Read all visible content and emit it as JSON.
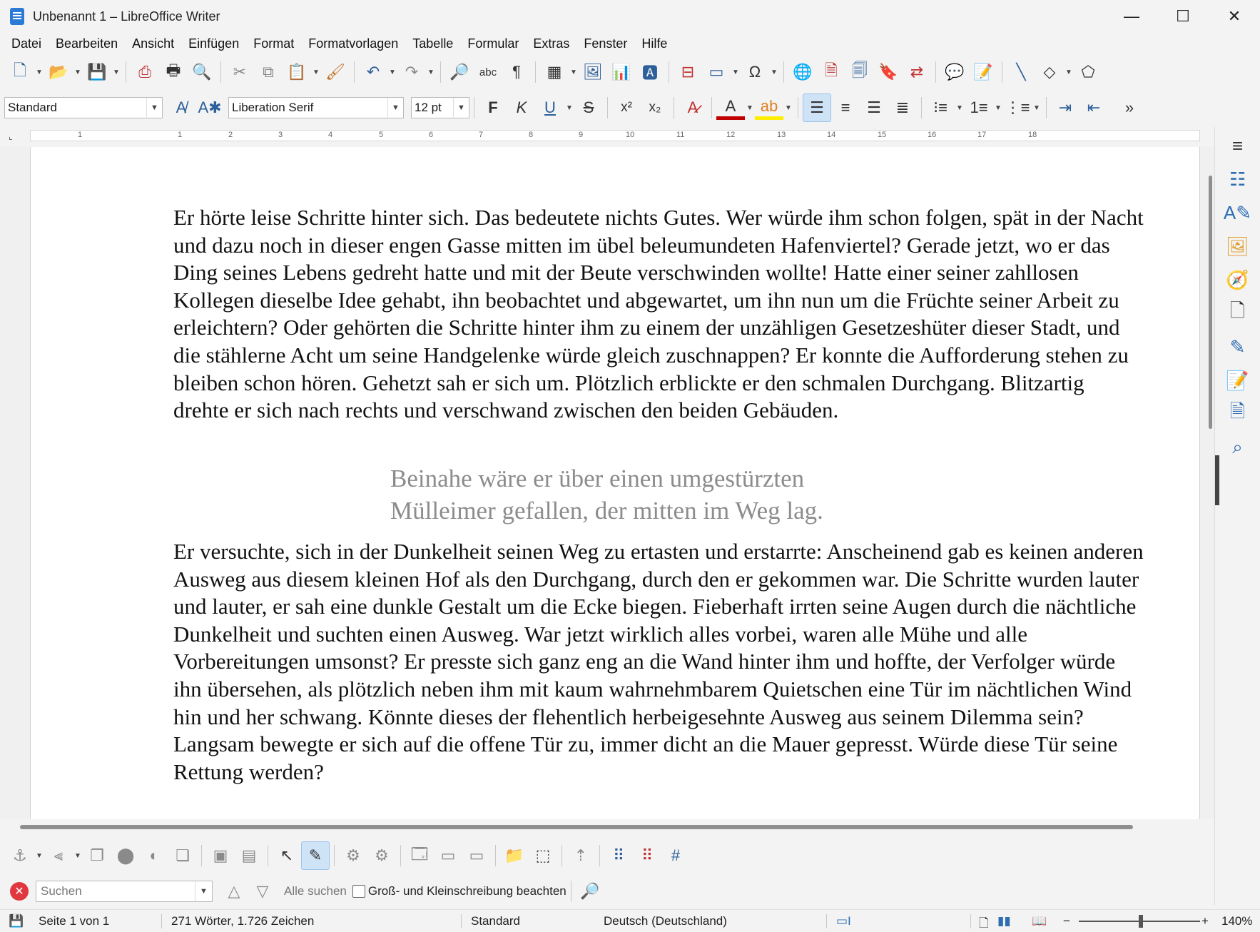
{
  "window": {
    "title": "Unbenannt 1 – LibreOffice Writer",
    "minimize": "—",
    "maximize": "☐",
    "close": "✕"
  },
  "menu": [
    "Datei",
    "Bearbeiten",
    "Ansicht",
    "Einfügen",
    "Format",
    "Formatvorlagen",
    "Tabelle",
    "Formular",
    "Extras",
    "Fenster",
    "Hilfe"
  ],
  "formatting": {
    "paragraph_style": "Standard",
    "font_name": "Liberation Serif",
    "font_size": "12 pt",
    "bold": "F",
    "italic": "K",
    "underline": "U",
    "strike": "S",
    "superscript": "x²",
    "subscript": "x₂"
  },
  "ruler": {
    "ticks": [
      "1",
      "1",
      "2",
      "3",
      "4",
      "5",
      "6",
      "7",
      "8",
      "9",
      "10",
      "11",
      "12",
      "13",
      "14",
      "15",
      "16",
      "17",
      "18"
    ]
  },
  "document": {
    "paragraph1": "Er hörte leise Schritte hinter sich. Das bedeutete nichts Gutes. Wer würde ihm schon folgen, spät in der Nacht und dazu noch in dieser engen Gasse mitten im übel beleumundeten Hafenviertel? Gerade jetzt, wo er das Ding seines Lebens gedreht hatte und mit der Beute verschwinden wollte! Hatte einer seiner zahllosen Kollegen dieselbe Idee gehabt, ihn beobachtet und abgewartet, um ihn nun um die Früchte seiner Arbeit zu erleichtern? Oder gehörten die Schritte hinter ihm zu einem der unzähligen Gesetzeshüter dieser Stadt, und die stählerne Acht um seine Handgelenke würde gleich zuschnappen? Er konnte die Aufforderung stehen zu bleiben schon hören. Gehetzt sah er sich um. Plötzlich erblickte er den schmalen Durchgang. Blitzartig drehte er sich nach rechts und verschwand zwischen den beiden Gebäuden.",
    "quote_line1": "Beinahe wäre er über einen umgestürzten",
    "quote_line2": "Mülleimer gefallen, der mitten im Weg lag.",
    "paragraph3": "Er versuchte, sich in der Dunkelheit seinen Weg zu ertasten und erstarrte: Anscheinend gab es keinen anderen Ausweg aus diesem kleinen Hof als den Durchgang, durch den er gekommen war. Die Schritte wurden lauter und lauter, er sah eine dunkle Gestalt um die Ecke biegen. Fieberhaft irrten seine Augen durch die nächtliche Dunkelheit und suchten einen Ausweg. War jetzt wirklich alles vorbei, waren alle Mühe und alle Vorbereitungen umsonst? Er presste sich ganz eng an die Wand hinter ihm und hoffte, der Verfolger würde ihn übersehen, als plötzlich neben ihm mit kaum wahrnehmbarem Quietschen eine Tür im nächtlichen Wind hin und her schwang. Könnte dieses der flehentlich herbeigesehnte Ausweg aus seinem Dilemma sein? Langsam bewegte er sich auf die offene Tür zu, immer dicht an die Mauer gepresst. Würde diese Tür seine Rettung werden?"
  },
  "findbar": {
    "placeholder": "Suchen",
    "find_all": "Alle suchen",
    "match_case": "Groß- und Kleinschreibung beachten"
  },
  "status": {
    "page": "Seite 1 von 1",
    "words": "271 Wörter, 1.726 Zeichen",
    "style": "Standard",
    "language": "Deutsch (Deutschland)",
    "zoom": "140%"
  },
  "colors": {
    "accent": "#2d6db2",
    "font_color_bar": "#c00000",
    "highlight_bar": "#ffee00",
    "close_red": "#e0383e"
  }
}
